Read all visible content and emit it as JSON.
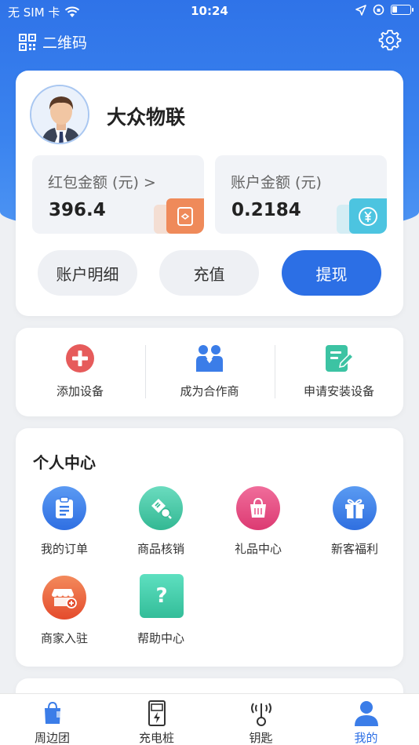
{
  "status": {
    "carrier": "无 SIM 卡",
    "time": "10:24"
  },
  "header": {
    "qr_label": "二维码"
  },
  "profile": {
    "name": "大众物联",
    "red_packet_label": "红包金额 (元) >",
    "red_packet_amount": "396.4",
    "account_label": "账户金额 (元)",
    "account_amount": "0.2184",
    "buttons": {
      "details": "账户明细",
      "recharge": "充值",
      "withdraw": "提现"
    }
  },
  "quick_actions": [
    {
      "label": "添加设备",
      "icon": "add-circle-icon"
    },
    {
      "label": "成为合作商",
      "icon": "partners-icon"
    },
    {
      "label": "申请安装设备",
      "icon": "edit-form-icon"
    }
  ],
  "personal_center": {
    "title": "个人中心",
    "items": [
      {
        "label": "我的订单",
        "icon": "clipboard-icon",
        "color": "#3b7de8"
      },
      {
        "label": "商品核销",
        "icon": "ticket-icon",
        "color": "#3cc3a3"
      },
      {
        "label": "礼品中心",
        "icon": "gift-bag-icon",
        "color": "#e6467f"
      },
      {
        "label": "新客福利",
        "icon": "gift-box-icon",
        "color": "#3d7fe6"
      },
      {
        "label": "商家入驻",
        "icon": "store-icon",
        "color": "#ea5a33"
      },
      {
        "label": "帮助中心",
        "icon": "help-icon",
        "color": "#3cc7a8"
      }
    ]
  },
  "tabbar": [
    {
      "label": "周边团",
      "icon": "shopping-bag-icon"
    },
    {
      "label": "充电桩",
      "icon": "charging-pile-icon"
    },
    {
      "label": "钥匙",
      "icon": "key-signal-icon"
    },
    {
      "label": "我的",
      "icon": "user-icon",
      "active": true
    }
  ],
  "colors": {
    "brand_blue": "#2c6fe5",
    "red_packet_accent": "#ef8a5a",
    "account_accent": "#4cc4e0"
  }
}
